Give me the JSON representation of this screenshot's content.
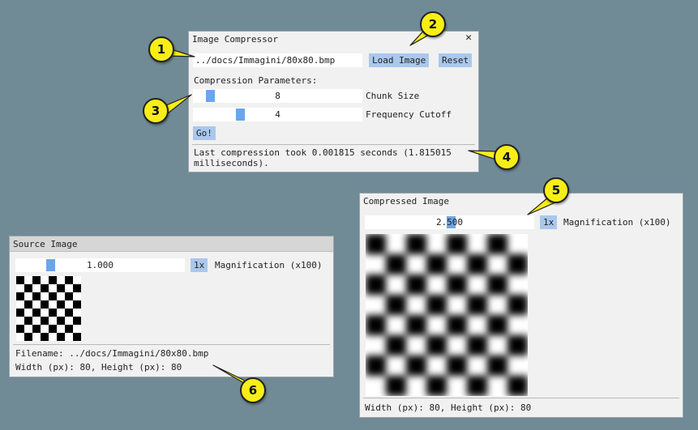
{
  "compressor": {
    "title": "Image Compressor",
    "close_label": "✕",
    "path_value": "../docs/Immagini/80x80.bmp",
    "load_label": "Load Image",
    "reset_label": "Reset",
    "params_label": "Compression Parameters:",
    "chunk_size_value": "8",
    "chunk_size_fraction": 0.08,
    "chunk_size_label": "Chunk Size",
    "freq_cutoff_value": "4",
    "freq_cutoff_fraction": 0.27,
    "freq_cutoff_label": "Frequency Cutoff",
    "go_label": "Go!",
    "status_line1": "Last compression took 0.001815 seconds (1.815015",
    "status_line2": "milliseconds)."
  },
  "compressed": {
    "title": "Compressed Image",
    "magnification_value": "2.500",
    "magnification_fraction": 0.51,
    "one_x_label": "1x",
    "magnification_label": "Magnification (x100)",
    "dims": "Width (px): 80, Height (px): 80"
  },
  "source": {
    "title": "Source Image",
    "magnification_value": "1.000",
    "magnification_fraction": 0.19,
    "one_x_label": "1x",
    "magnification_label": "Magnification (x100)",
    "filename": "Filename: ../docs/Immagini/80x80.bmp",
    "dims": "Width (px): 80, Height (px): 80"
  },
  "callouts": [
    "1",
    "2",
    "3",
    "4",
    "5",
    "6"
  ],
  "colors": {
    "background": "#708a96",
    "button": "#a9c8ec",
    "slider_knob": "#6aa6ec",
    "callout": "#f7ee18"
  }
}
